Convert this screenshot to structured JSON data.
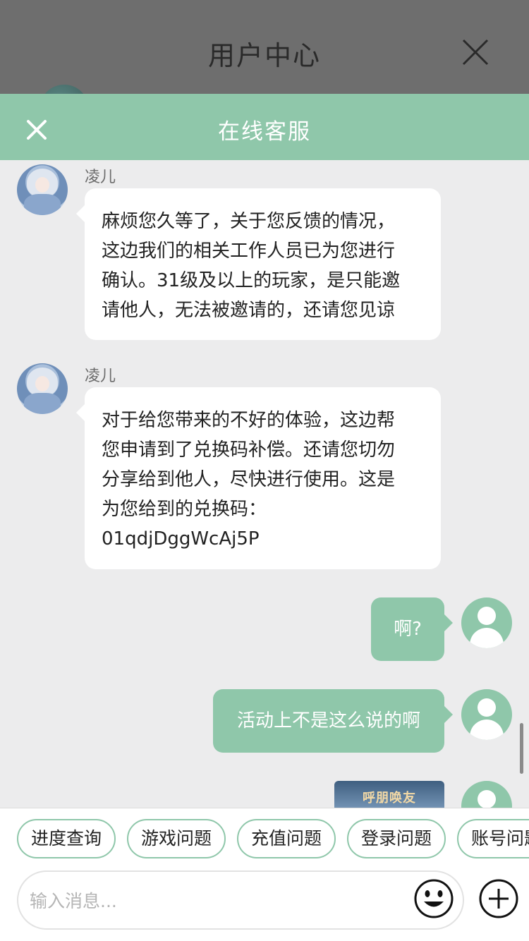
{
  "background": {
    "title": "用户中心"
  },
  "header": {
    "title": "在线客服"
  },
  "messages": [
    {
      "sender": "凌儿",
      "text": "麻烦您久等了，关于您反馈的情况，\n这边我们的相关工作人员已为您进行\n确认。31级及以上的玩家，是只能邀\n请他人，无法被邀请的，还请您见谅"
    },
    {
      "sender": "凌儿",
      "text": "对于给您带来的不好的体验，这边帮\n您申请到了兑换码补偿。还请您切勿\n分享给到他人，尽快进行使用。这是\n为您给到的兑换码：\n01qdjDggWcAj5P"
    },
    {
      "sender": "me",
      "text": "啊?"
    },
    {
      "sender": "me",
      "text": "活动上不是这么说的啊"
    }
  ],
  "image_message": {
    "title": "呼朋唤友"
  },
  "quick_replies": [
    "进度查询",
    "游戏问题",
    "充值问题",
    "登录问题",
    "账号问题"
  ],
  "input": {
    "placeholder": "输入消息..."
  },
  "colors": {
    "accent": "#8fc7aa",
    "bubble_agent": "#ffffff",
    "chat_bg": "#ececed"
  },
  "icons": [
    "close-icon",
    "emoji-icon",
    "plus-icon",
    "user-avatar-icon"
  ]
}
